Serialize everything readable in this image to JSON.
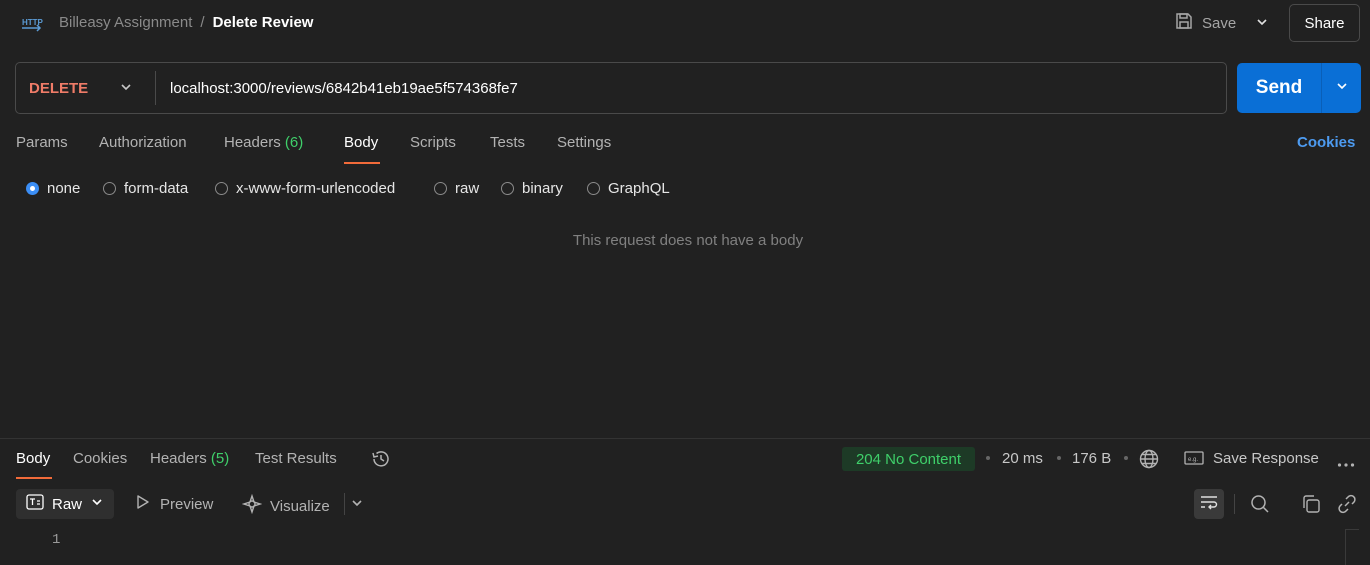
{
  "header": {
    "icon": "http-icon",
    "collection": "Billeasy Assignment",
    "separator": "/",
    "request_name": "Delete Review",
    "save_label": "Save",
    "share_label": "Share"
  },
  "request": {
    "method": "DELETE",
    "url": "localhost:3000/reviews/6842b41eb19ae5f574368fe7",
    "send_label": "Send",
    "method_color": "#f07c68",
    "send_color": "#0a6fd6"
  },
  "request_tabs": [
    {
      "label": "Params"
    },
    {
      "label": "Authorization"
    },
    {
      "label": "Headers",
      "count": "(6)"
    },
    {
      "label": "Body",
      "active": true
    },
    {
      "label": "Scripts"
    },
    {
      "label": "Tests"
    },
    {
      "label": "Settings"
    }
  ],
  "cookies_link": "Cookies",
  "body_types": [
    {
      "label": "none",
      "selected": true
    },
    {
      "label": "form-data"
    },
    {
      "label": "x-www-form-urlencoded"
    },
    {
      "label": "raw"
    },
    {
      "label": "binary"
    },
    {
      "label": "GraphQL"
    }
  ],
  "empty_body_message": "This request does not have a body",
  "response": {
    "tabs": [
      {
        "label": "Body",
        "active": true
      },
      {
        "label": "Cookies"
      },
      {
        "label": "Headers",
        "count": "(5)"
      },
      {
        "label": "Test Results"
      }
    ],
    "status": "204 No Content",
    "status_color": "#3fcf6a",
    "time": "20 ms",
    "size": "176 B",
    "save_response_label": "Save Response",
    "format": "Raw",
    "preview_label": "Preview",
    "visualize_label": "Visualize",
    "line_number": "1"
  }
}
